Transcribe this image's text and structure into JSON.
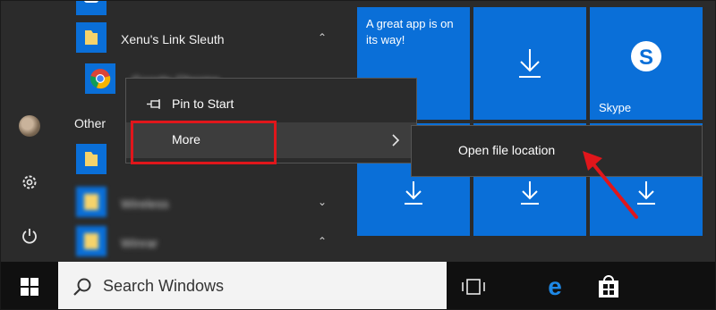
{
  "app_list": {
    "top_app_label": "Xenu's Link Sleuth",
    "chrome_label": "Google Chrome",
    "group_header": "Other",
    "blurred_1": "Wireless",
    "blurred_2": "Winrar"
  },
  "context_menu": {
    "pin_label": "Pin to Start",
    "more_label": "More",
    "submenu_label": "Open file location"
  },
  "tiles": {
    "notice_text": "A great app is on its way!",
    "skype_label": "Skype"
  },
  "taskbar": {
    "search_placeholder": "Search Windows"
  },
  "colors": {
    "tile_blue": "#0a6fd8",
    "annotation_red": "#e0161b",
    "start_bg": "#2b2b2b"
  },
  "icons": [
    "chevron-up-icon",
    "chevron-down-icon",
    "folder-icon",
    "chrome-icon",
    "pin-icon",
    "chevron-right-icon",
    "download-icon",
    "skype-icon",
    "gear-icon",
    "power-icon",
    "windows-logo-icon",
    "search-icon",
    "task-view-icon",
    "edge-icon",
    "store-icon",
    "annotation-arrow-icon"
  ]
}
